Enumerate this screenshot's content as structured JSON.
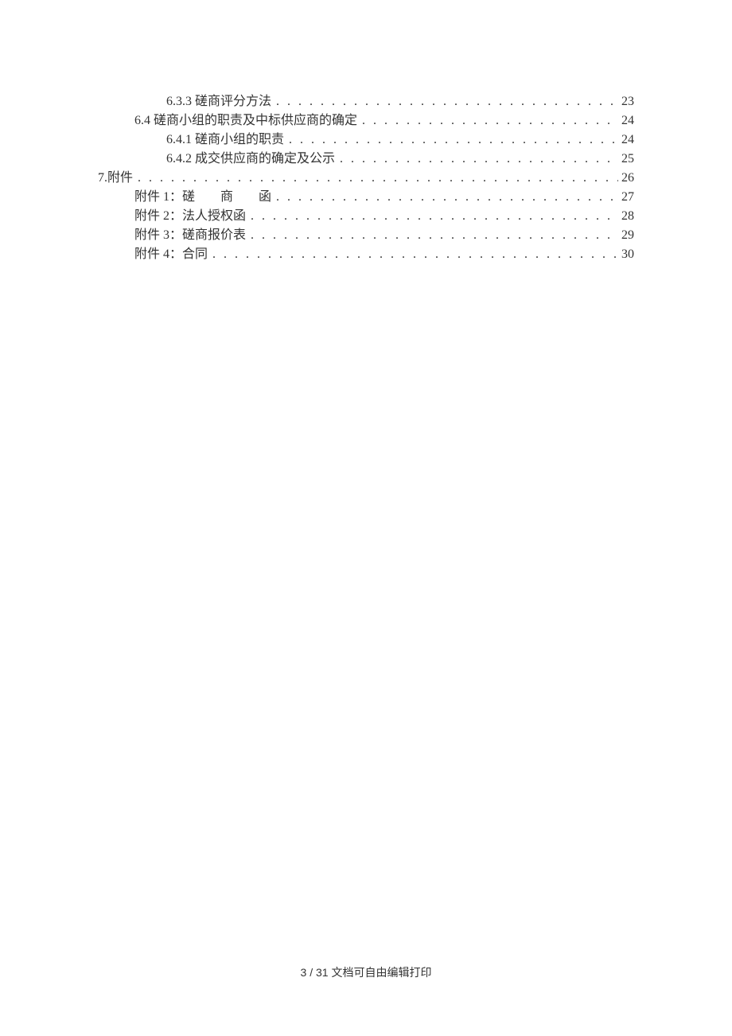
{
  "toc": {
    "entries": [
      {
        "indent": 2,
        "text": "6.3.3 磋商评分方法",
        "page": "23"
      },
      {
        "indent": 1,
        "text": "6.4 磋商小组的职责及中标供应商的确定",
        "page": "24"
      },
      {
        "indent": 2,
        "text": "6.4.1 磋商小组的职责",
        "page": "24"
      },
      {
        "indent": 2,
        "text": "6.4.2 成交供应商的确定及公示",
        "page": "25"
      },
      {
        "indent": 0,
        "text": "7.附件",
        "page": "26"
      },
      {
        "indent": 1,
        "text": "附件 1：磋　　商　　函",
        "page": "27"
      },
      {
        "indent": 1,
        "text": "附件 2：法人授权函",
        "page": "28"
      },
      {
        "indent": 1,
        "text": "附件 3：磋商报价表",
        "page": "29"
      },
      {
        "indent": 1,
        "text": "附件 4：合同",
        "page": "30"
      }
    ]
  },
  "footer": {
    "text": "3 / 31 文档可自由编辑打印"
  }
}
